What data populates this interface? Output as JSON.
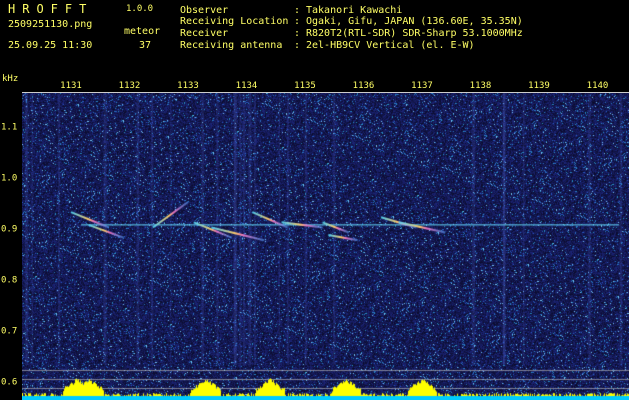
{
  "app": {
    "title": "HROFFT",
    "version": "1.0.0",
    "file_name": "2509251130.png",
    "date_time": "25.09.25 11:30",
    "mode_label": "meteor",
    "meteor_count": "37"
  },
  "info": [
    {
      "label": "Observer",
      "value": "Takanori Kawachi"
    },
    {
      "label": "Receiving Location",
      "value": "Ogaki, Gifu, JAPAN (136.60E, 35.35N)"
    },
    {
      "label": "Receiver",
      "value": "R820T2(RTL-SDR) SDR-Sharp 53.1000MHz"
    },
    {
      "label": "Receiving antenna",
      "value": "2el-HB9CV Vertical (el. E-W)"
    }
  ],
  "info_separator": ":",
  "axes": {
    "y_unit": "kHz",
    "x_ticks": [
      "1131",
      "1132",
      "1133",
      "1134",
      "1135",
      "1136",
      "1137",
      "1138",
      "1139",
      "1140"
    ],
    "y_ticks": [
      "1.1",
      "1.0",
      "0.9",
      "0.8",
      "0.7",
      "0.6"
    ]
  },
  "colors": {
    "text": "#ffff66",
    "background_noise": "#0a1040",
    "carrier": "#66ddff",
    "echo_core": "#ffcc66",
    "level_fill": "#ffff00",
    "level_base": "#00ccff"
  },
  "chart_data": {
    "type": "heatmap",
    "x_range": [
      1131,
      1140
    ],
    "y_range_khz": [
      0.59,
      1.2
    ],
    "carrier_khz": 0.91,
    "echoes": [
      {
        "x_start": 1131.0,
        "x_end": 1131.65,
        "y_start": 0.935,
        "y_end": 0.905
      },
      {
        "x_start": 1131.3,
        "x_end": 1131.9,
        "y_start": 0.91,
        "y_end": 0.885
      },
      {
        "x_start": 1132.4,
        "x_end": 1133.0,
        "y_start": 0.905,
        "y_end": 0.955
      },
      {
        "x_start": 1133.1,
        "x_end": 1133.75,
        "y_start": 0.915,
        "y_end": 0.885
      },
      {
        "x_start": 1133.4,
        "x_end": 1134.3,
        "y_start": 0.905,
        "y_end": 0.88
      },
      {
        "x_start": 1134.1,
        "x_end": 1134.7,
        "y_start": 0.935,
        "y_end": 0.905
      },
      {
        "x_start": 1134.6,
        "x_end": 1135.3,
        "y_start": 0.915,
        "y_end": 0.905
      },
      {
        "x_start": 1135.3,
        "x_end": 1135.75,
        "y_start": 0.915,
        "y_end": 0.895
      },
      {
        "x_start": 1135.4,
        "x_end": 1135.9,
        "y_start": 0.89,
        "y_end": 0.88
      },
      {
        "x_start": 1136.3,
        "x_end": 1136.9,
        "y_start": 0.925,
        "y_end": 0.905
      },
      {
        "x_start": 1136.6,
        "x_end": 1137.4,
        "y_start": 0.915,
        "y_end": 0.895
      }
    ],
    "level_peaks": [
      1131.1,
      1131.3,
      1133.3,
      1134.4,
      1135.7,
      1137.0
    ]
  }
}
